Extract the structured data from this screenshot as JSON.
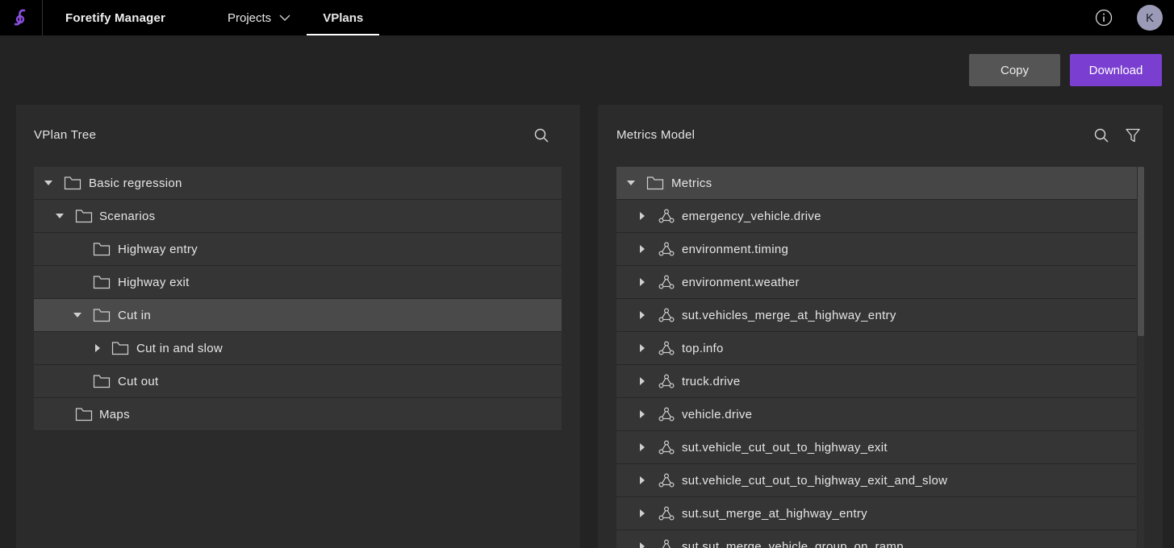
{
  "app": {
    "title": "Foretify Manager",
    "avatar_initial": "K"
  },
  "nav": {
    "items": [
      {
        "label": "Projects",
        "has_dropdown": true
      },
      {
        "label": "VPlans",
        "active": true
      }
    ]
  },
  "actions": {
    "copy_label": "Copy",
    "download_label": "Download"
  },
  "colors": {
    "accent": "#7a3fd1",
    "background": "#232323",
    "panel": "#2b2b2b",
    "row": "#353535",
    "row_selected": "#4a4a4a"
  },
  "vplan_tree": {
    "title": "VPlan Tree",
    "rows": [
      {
        "label": "Basic regression",
        "expanded": true,
        "has_toggle": true
      },
      {
        "label": "Scenarios",
        "expanded": true,
        "has_toggle": true
      },
      {
        "label": "Highway entry",
        "has_toggle": false
      },
      {
        "label": "Highway exit",
        "has_toggle": false
      },
      {
        "label": "Cut in",
        "expanded": true,
        "has_toggle": true,
        "selected": true
      },
      {
        "label": "Cut in and slow",
        "expanded": false,
        "has_toggle": true
      },
      {
        "label": "Cut out",
        "has_toggle": false
      },
      {
        "label": "Maps",
        "has_toggle": false
      }
    ]
  },
  "metrics_model": {
    "title": "Metrics Model",
    "root": {
      "label": "Metrics",
      "expanded": true
    },
    "items": [
      "emergency_vehicle.drive",
      "environment.timing",
      "environment.weather",
      "sut.vehicles_merge_at_highway_entry",
      "top.info",
      "truck.drive",
      "vehicle.drive",
      "sut.vehicle_cut_out_to_highway_exit",
      "sut.vehicle_cut_out_to_highway_exit_and_slow",
      "sut.sut_merge_at_highway_entry",
      "sut.sut_merge_vehicle_group_on_ramp"
    ]
  },
  "icons": [
    "logo-icon",
    "chevron-down-icon",
    "info-icon",
    "search-icon",
    "filter-icon",
    "folder-icon",
    "caret-down-icon",
    "caret-right-icon",
    "metric-group-icon"
  ]
}
